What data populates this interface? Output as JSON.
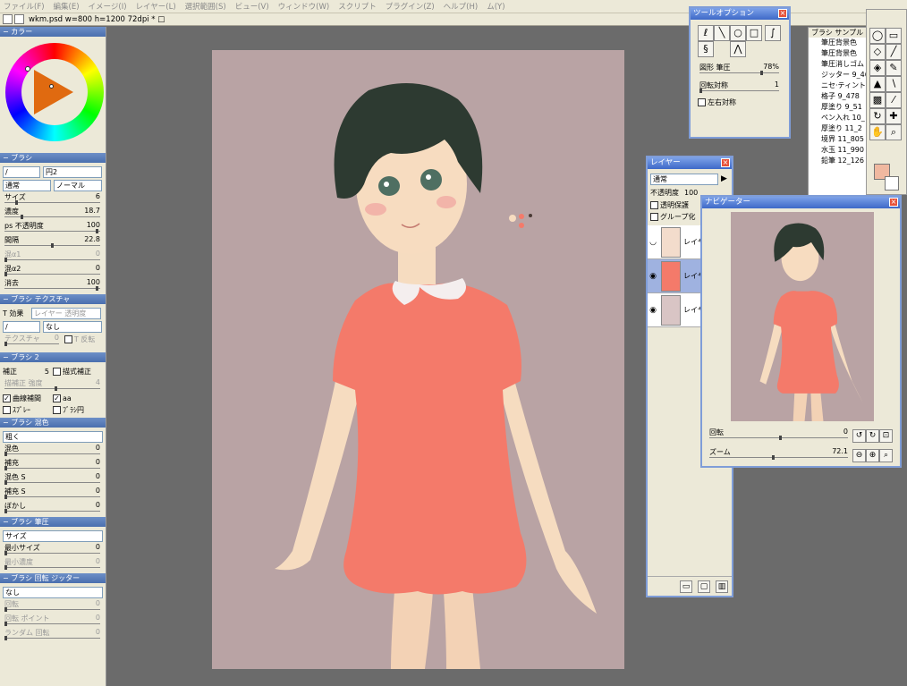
{
  "menu": [
    "ファイル(F)",
    "編集(E)",
    "イメージ(I)",
    "レイヤー(L)",
    "選択範囲(S)",
    "ビュー(V)",
    "ウィンドウ(W)",
    "スクリプト",
    "プラグイン(Z)",
    "ヘルプ(H)",
    "ム(Y)"
  ],
  "doc": {
    "title": "wkm.psd w=800 h=1200 72dpi * □"
  },
  "color_panel": {
    "header": "カラー"
  },
  "brush": {
    "header": "ブラシ",
    "shape": "/",
    "tip": "円2",
    "mode": "通常",
    "type": "ノーマル",
    "size_label": "サイズ",
    "size_value": "6",
    "density_label": "濃度",
    "density_value": "18.7",
    "opacity_label": "ps 不透明度",
    "opacity_value": "100",
    "spacing_label": "間隔",
    "spacing_value": "22.8",
    "mix1_label": "混α1",
    "mix1_value": "0",
    "mix2_label": "混α2",
    "mix2_value": "0",
    "erase_label": "消去",
    "erase_value": "100"
  },
  "texture": {
    "header": "ブラシ テクスチャ",
    "effect_label": "T 効果",
    "effect_value": "レイヤー 透明度",
    "shape": "/",
    "name": "なし",
    "texture_label": "テクスチャ",
    "texture_value": "0",
    "invert_label": "T 反転"
  },
  "brush2": {
    "header": "ブラシ 2",
    "correction_label": "補正",
    "correction_value": "5",
    "line_correction_label": "描式補正",
    "strength_label": "描補正 強度",
    "strength_value": "4",
    "curve_label": "曲線補間",
    "aa_label": "aa",
    "spray_label": "ｽﾌﾟﾚｰ",
    "brush_circle_label": "ﾌﾞﾗｼ円"
  },
  "blend": {
    "header": "ブラシ 混色",
    "mode": "粗く",
    "mix_label": "混色",
    "mix_value": "0",
    "fill_label": "補充",
    "fill_value": "0",
    "mix_s_label": "混色 S",
    "mix_s_value": "0",
    "fill_s_label": "補充 S",
    "fill_s_value": "0",
    "blur_label": "ぼかし",
    "blur_value": "0"
  },
  "pressure": {
    "header": "ブラシ 筆圧",
    "target": "サイズ",
    "min_size_label": "最小サイズ",
    "min_size_value": "0",
    "min_density_label": "最小濃度",
    "min_density_value": "0"
  },
  "jitter": {
    "header": "ブラシ 回転 ジッター",
    "mode": "なし",
    "rotate_label": "回転",
    "rotate_value": "0",
    "point_label": "回転 ポイント",
    "point_value": "0",
    "random_label": "ランダム 回転",
    "random_value": "0"
  },
  "tool_options": {
    "title": "ツールオプション",
    "shape_label": "図形 筆圧",
    "shape_value": "78%",
    "rotate_sym_label": "回転対称",
    "rotate_sym_value": "1",
    "mirror_label": "左右対称"
  },
  "layers": {
    "title": "レイヤー",
    "mode": "通常",
    "opacity_label": "不透明度",
    "opacity_value": "100",
    "protect_label": "透明保護",
    "group_label": "グループ化",
    "rows": [
      "レイヤー",
      "レイヤー",
      "レイヤー"
    ]
  },
  "navigator": {
    "title": "ナビゲーター",
    "rotate_label": "回転",
    "rotate_value": "0",
    "zoom_label": "ズーム",
    "zoom_value": "72.1"
  },
  "samples": {
    "header": "ブラシ サンプル",
    "items": [
      "筆圧背景色",
      "筆圧背景色",
      "筆圧消しゴム",
      "ジッター 9_46",
      "ニセ·ティント",
      "格子 9_478",
      "厚塗り 9_51",
      "ペン入れ 10_",
      "厚塗り 11_2",
      "境界 11_805",
      "水玉 11_990",
      "鉛筆 12_126"
    ]
  },
  "colors": {
    "accent": "#4a6fae",
    "canvas_bg": "#b9a3a4",
    "dress": "#f47a6a",
    "hair": "#2d3a31",
    "skin": "#f7dcc0"
  }
}
